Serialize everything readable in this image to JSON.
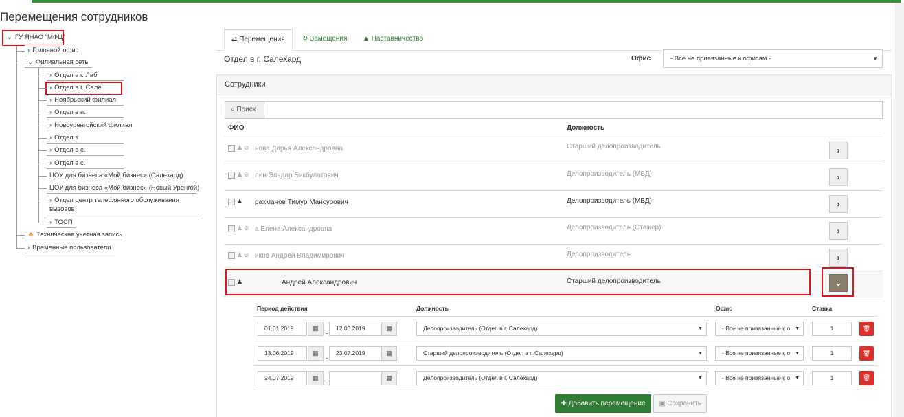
{
  "page_title": "Перемещения сотрудников",
  "colors": {
    "accent": "#3c8d3c",
    "highlight": "#e0141e",
    "danger": "#d9322d"
  },
  "tree": {
    "root": "ГУ ЯНАО \"МФЦ\"",
    "head_office": "Головной офис",
    "branch_network": "Филиальная сеть",
    "branches": [
      "Отдел в г. Лаб",
      "Отдел в г. Сале",
      "Ноябрьский филиал",
      "Отдел в п.",
      "Новоуренгойский филиал",
      "Отдел в",
      "Отдел в с.",
      "Отдел в с."
    ],
    "extra": [
      "ЦОУ для бизнеса «Мой бизнес» (Салехард)",
      "ЦОУ для бизнеса «Мой бизнес» (Новый Уренгой)",
      "Отдел центр телефонного обслуживания вызовов",
      "ТОСП"
    ],
    "tech_account": "Техническая учетная запись",
    "temp_users": "Временные пользователи"
  },
  "tabs": [
    {
      "label": "Перемещения",
      "icon": "exchange-icon"
    },
    {
      "label": "Замещения",
      "icon": "refresh-icon"
    },
    {
      "label": "Наставничество",
      "icon": "graduation-cap-icon"
    }
  ],
  "department": "Отдел в г. Салехард",
  "office_filter": {
    "label": "Офис",
    "value": "- Все не привязанные к офисам -"
  },
  "employees_panel": {
    "title": "Сотрудники",
    "search_button": "Поиск",
    "col_name": "ФИО",
    "col_position": "Должность",
    "rows": [
      {
        "name": "нова Дарья Александровна",
        "position": "Старший делопроизводитель",
        "dim": true
      },
      {
        "name": "лин Эльдар Бикбулатович",
        "position": "Делопроизводитель (МВД)",
        "dim": true
      },
      {
        "name": "рахманов Тимур Мансурович",
        "position": "Делопроизводитель (МВД)",
        "dim": false
      },
      {
        "name": "а Елена Александровна",
        "position": "Делопроизводитель (Стажер)",
        "dim": true
      },
      {
        "name": "иков Андрей Владимирович",
        "position": "Делопроизводитель",
        "dim": true
      },
      {
        "name": "Андрей Александрович",
        "position": "Старший делопроизводитель",
        "dim": false
      }
    ]
  },
  "transfers": {
    "col_period": "Период действия",
    "col_position": "Должность",
    "col_office": "Офис",
    "col_rate": "Ставка",
    "rows": [
      {
        "from": "01.01.2019",
        "to": "12.06.2019",
        "position": "Делопроизводитель (Отдел в г. Салехард)",
        "office": "- Все не привязанные к о",
        "rate": "1"
      },
      {
        "from": "13.06.2019",
        "to": "23.07.2019",
        "position": "Старший делопроизводитель (Отдел в г. Салехард)",
        "office": "- Все не привязанные к о",
        "rate": "1"
      },
      {
        "from": "24.07.2019",
        "to": "",
        "position": "Делопроизводитель (Отдел в г. Салехард)",
        "office": "- Все не привязанные к о",
        "rate": "1"
      }
    ],
    "add_button": "Добавить перемещение",
    "save_button": "Сохранить"
  }
}
